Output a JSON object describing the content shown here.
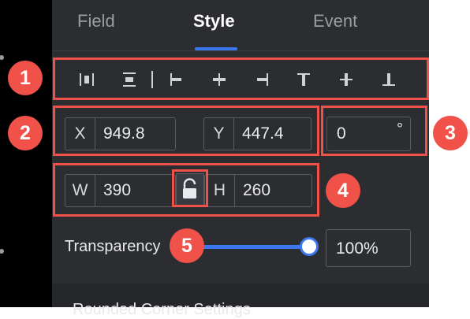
{
  "tabs": [
    {
      "label": "Field",
      "active": false
    },
    {
      "label": "Style",
      "active": true
    },
    {
      "label": "Event",
      "active": false
    }
  ],
  "alignment_icons": [
    "distribute-horizontal-icon",
    "distribute-vertical-icon",
    "align-left-icon",
    "align-center-horizontal-icon",
    "align-right-icon",
    "align-top-icon",
    "align-middle-vertical-icon",
    "align-bottom-icon"
  ],
  "position": {
    "x_label": "X",
    "x_value": "949.8",
    "y_label": "Y",
    "y_value": "447.4"
  },
  "rotation": {
    "value": "0",
    "unit": "°"
  },
  "size": {
    "w_label": "W",
    "w_value": "390",
    "h_label": "H",
    "h_value": "260",
    "lock_icon": "unlocked-padlock-icon"
  },
  "transparency": {
    "label": "Transparency",
    "value": "100%",
    "level": 1.0
  },
  "partial_heading": "Rounded Corner Settings",
  "badges": [
    "1",
    "2",
    "3",
    "4",
    "5"
  ],
  "colors": {
    "panel_bg": "#2c2d31",
    "accent": "#3b78f0",
    "annotation": "#f0524a",
    "border": "#5b5c62",
    "text": "#e8e9ec"
  }
}
